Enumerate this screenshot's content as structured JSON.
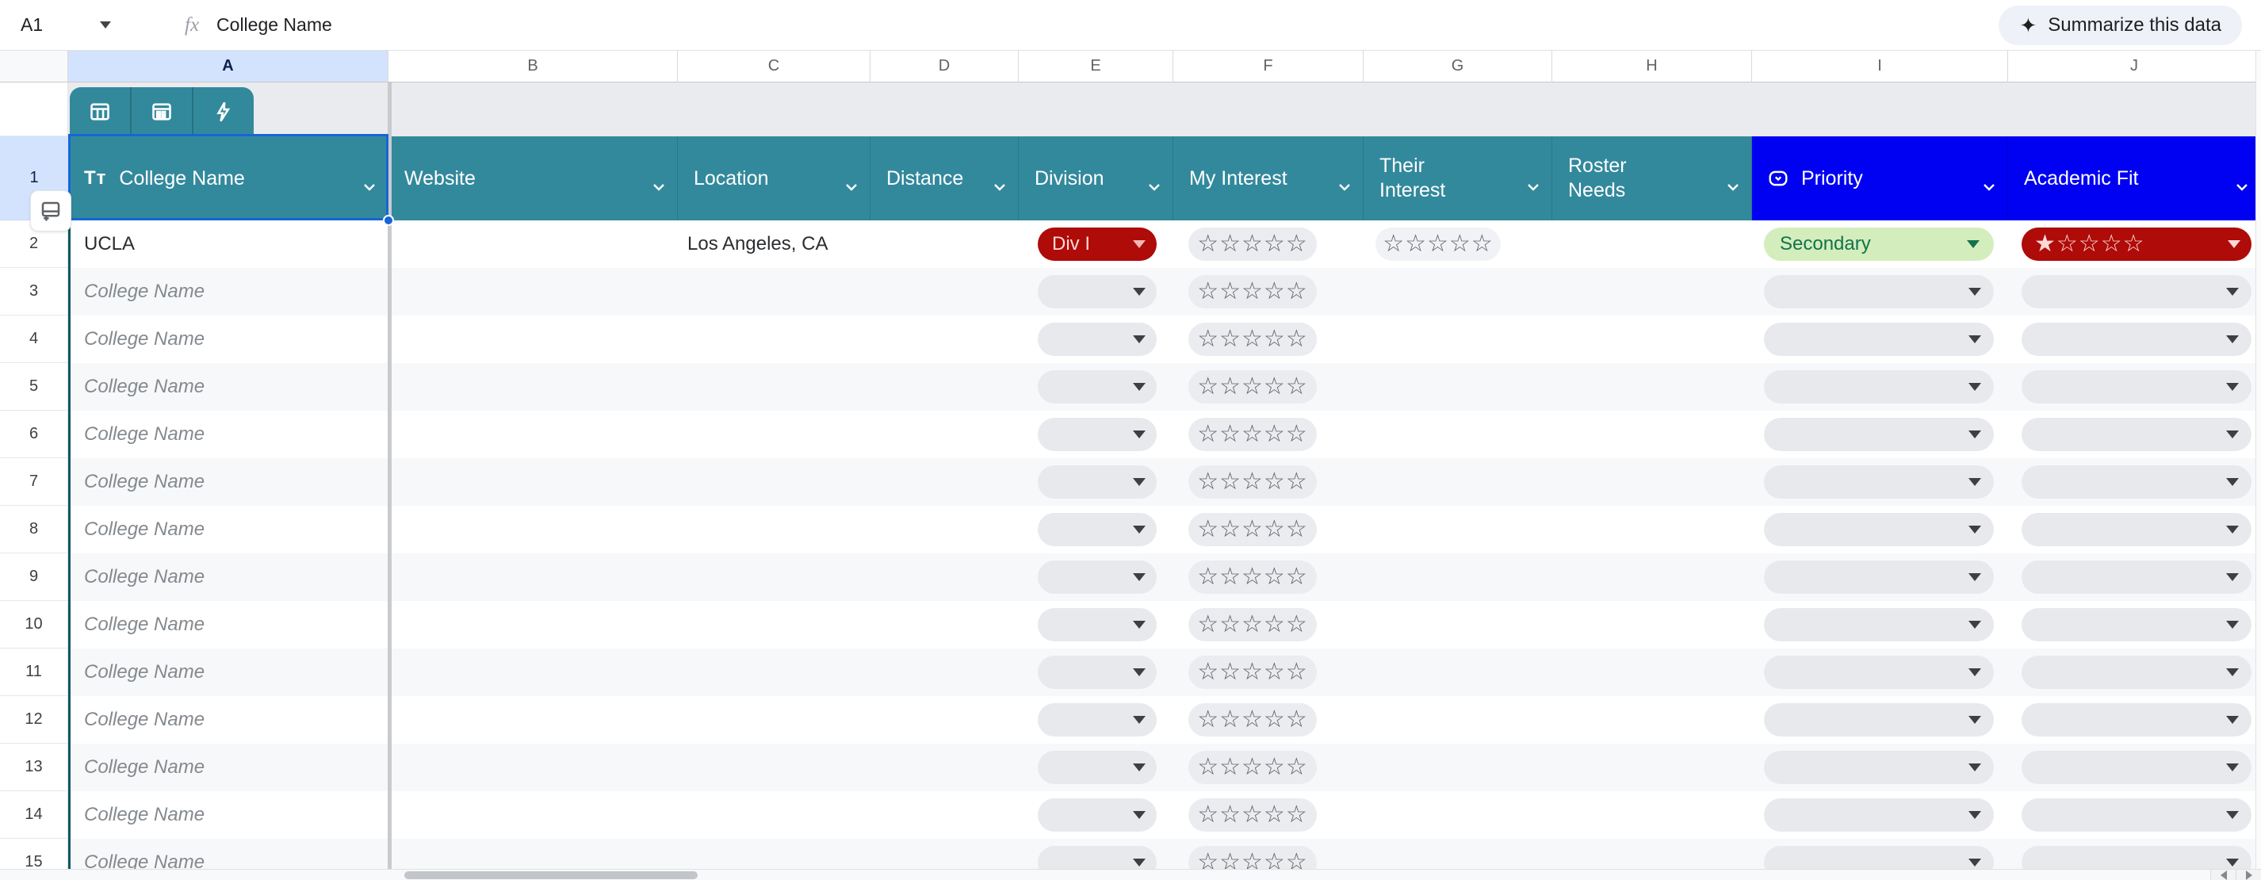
{
  "formula_bar": {
    "name_box": "A1",
    "fx_label": "fx",
    "formula": "College Name",
    "summarize_label": "Summarize this data",
    "sparkle": "✦"
  },
  "columns": [
    {
      "letter": "A",
      "label": "College Name",
      "type_icon": "Tт"
    },
    {
      "letter": "B",
      "label": "Website"
    },
    {
      "letter": "C",
      "label": "Location"
    },
    {
      "letter": "D",
      "label": "Distance"
    },
    {
      "letter": "E",
      "label": "Division"
    },
    {
      "letter": "F",
      "label": "My Interest"
    },
    {
      "letter": "G",
      "label": "Their Interest"
    },
    {
      "letter": "H",
      "label": "Roster Needs"
    },
    {
      "letter": "I",
      "label": "Priority"
    },
    {
      "letter": "J",
      "label": "Academic Fit"
    }
  ],
  "selection": {
    "selected_cell": "A1",
    "selected_column": "A",
    "selected_row": "1",
    "row1_number": "1"
  },
  "row2": {
    "number": "2",
    "college_name": "UCLA",
    "location": "Los Angeles, CA",
    "division_chip": "Div I",
    "my_interest_stars": "☆☆☆☆☆",
    "their_interest_stars": "☆☆☆☆☆",
    "priority_chip": "Secondary",
    "academic_fit_filled_star": "★",
    "academic_fit_empty_stars": "☆☆☆☆"
  },
  "placeholder_rows": {
    "numbers": [
      "3",
      "4",
      "5",
      "6",
      "7",
      "8",
      "9",
      "10",
      "11",
      "12",
      "13",
      "14",
      "15"
    ],
    "college_placeholder": "College Name",
    "empty_stars": "☆☆☆☆☆"
  },
  "colors": {
    "header_teal": "#33899C",
    "header_blue": "#0000F2",
    "selection_blue": "#1665D8",
    "chip_red_bg": "#AE0B09",
    "chip_red_text": "#FFD9D6",
    "chip_green_bg": "#D4EDBC",
    "chip_green_text": "#11734B",
    "pill_gray": "#E7E9ED",
    "selected_header_bg": "#D3E3FD",
    "row_band": "#F7F8FA"
  }
}
